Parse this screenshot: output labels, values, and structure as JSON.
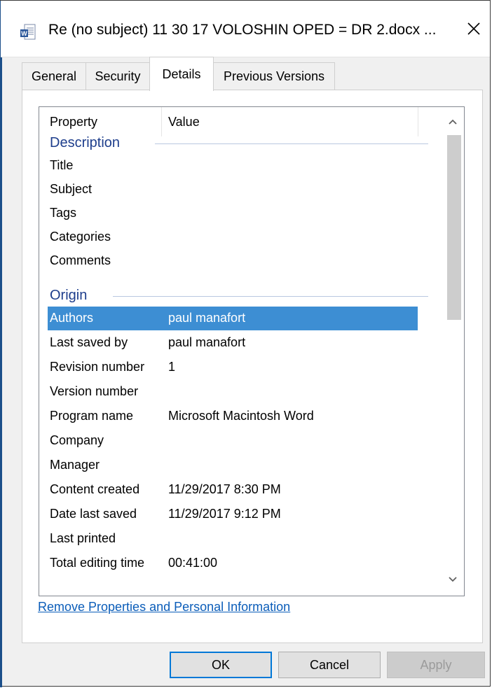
{
  "window": {
    "title": "Re  (no subject) 11 30 17 VOLOSHIN OPED = DR 2.docx ...",
    "icon": "word-document-icon",
    "close_icon": "close-icon"
  },
  "tabs": [
    {
      "label": "General",
      "active": false
    },
    {
      "label": "Security",
      "active": false
    },
    {
      "label": "Details",
      "active": true
    },
    {
      "label": "Previous Versions",
      "active": false
    }
  ],
  "details": {
    "header": {
      "property": "Property",
      "value": "Value"
    },
    "groups": [
      {
        "name": "Description",
        "rows": [
          {
            "property": "Title",
            "value": ""
          },
          {
            "property": "Subject",
            "value": ""
          },
          {
            "property": "Tags",
            "value": ""
          },
          {
            "property": "Categories",
            "value": ""
          },
          {
            "property": "Comments",
            "value": ""
          }
        ]
      },
      {
        "name": "Origin",
        "rows": [
          {
            "property": "Authors",
            "value": "paul manafort",
            "selected": true
          },
          {
            "property": "Last saved by",
            "value": "paul manafort"
          },
          {
            "property": "Revision number",
            "value": "1"
          },
          {
            "property": "Version number",
            "value": ""
          },
          {
            "property": "Program name",
            "value": "Microsoft Macintosh Word"
          },
          {
            "property": "Company",
            "value": ""
          },
          {
            "property": "Manager",
            "value": ""
          },
          {
            "property": "Content created",
            "value": "11/29/2017 8:30 PM"
          },
          {
            "property": "Date last saved",
            "value": "11/29/2017 9:12 PM"
          },
          {
            "property": "Last printed",
            "value": ""
          },
          {
            "property": "Total editing time",
            "value": "00:41:00"
          }
        ]
      }
    ]
  },
  "links": {
    "remove_properties": "Remove Properties and Personal Information"
  },
  "buttons": {
    "ok": "OK",
    "cancel": "Cancel",
    "apply": "Apply"
  },
  "colors": {
    "selection": "#3d8ed3",
    "group_header": "#1e3e8c",
    "link": "#0b5db9",
    "default_button_border": "#0078d7"
  }
}
